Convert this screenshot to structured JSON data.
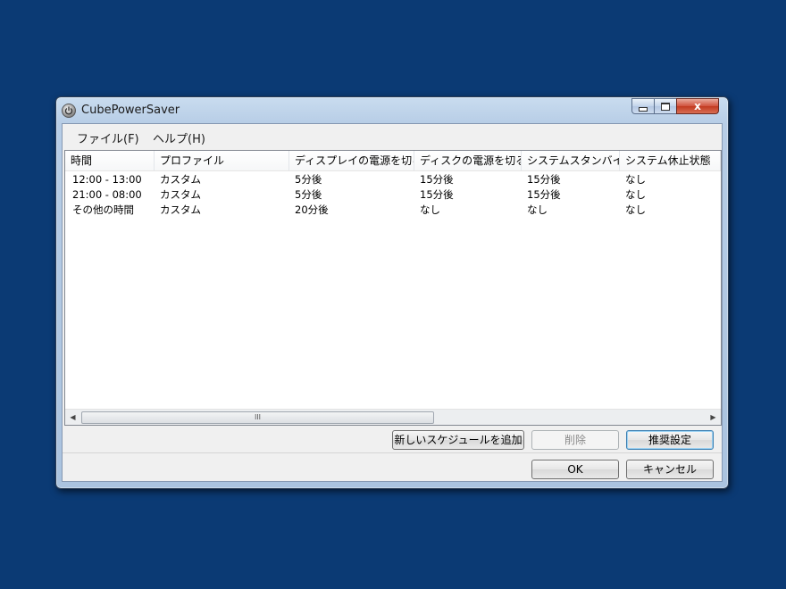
{
  "window": {
    "title": "CubePowerSaver",
    "controls": {
      "close": "x"
    }
  },
  "menu": [
    {
      "label": "ファイル(F)"
    },
    {
      "label": "ヘルプ(H)"
    }
  ],
  "list": {
    "columns": [
      "時間",
      "プロファイル",
      "ディスプレイの電源を切る",
      "ディスクの電源を切る",
      "システムスタンバイ",
      "システム休止状態"
    ],
    "rows": [
      [
        "12:00 - 13:00",
        "カスタム",
        "5分後",
        "15分後",
        "15分後",
        "なし"
      ],
      [
        "21:00 - 08:00",
        "カスタム",
        "5分後",
        "15分後",
        "15分後",
        "なし"
      ],
      [
        "その他の時間",
        "カスタム",
        "20分後",
        "なし",
        "なし",
        "なし"
      ]
    ],
    "scroll_grip": "III"
  },
  "buttons": {
    "add_schedule": "新しいスケジュールを追加",
    "delete": "削除",
    "recommended": "推奨設定",
    "ok": "OK",
    "cancel": "キャンセル"
  }
}
